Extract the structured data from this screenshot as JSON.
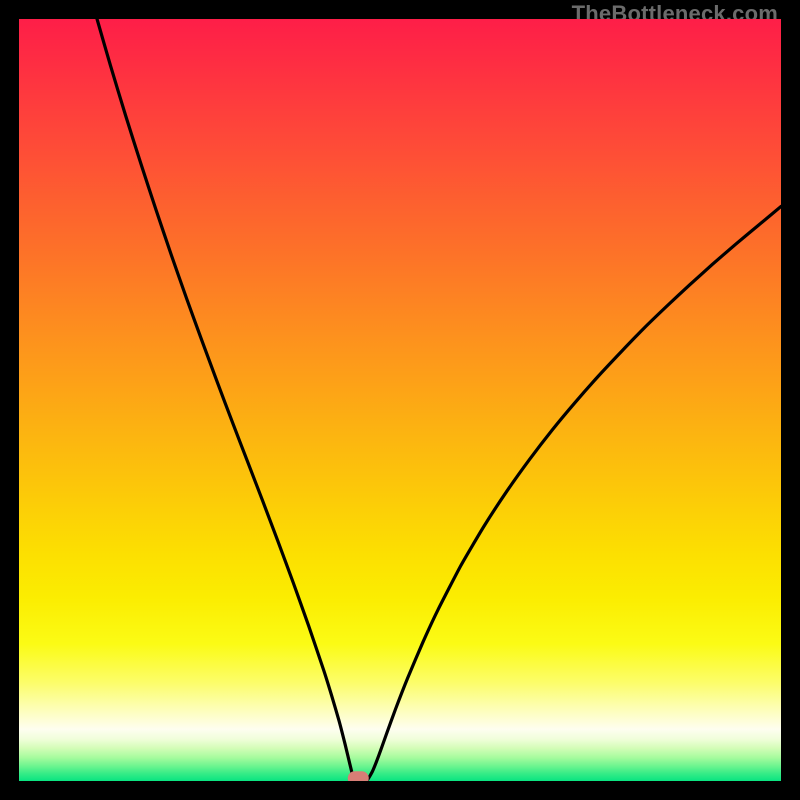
{
  "watermark": {
    "text": "TheBottleneck.com"
  },
  "colors": {
    "dot": "#d77e76",
    "curve": "#000000",
    "gradient_stops": [
      {
        "offset": 0.0,
        "color": "#fe1e48"
      },
      {
        "offset": 0.06,
        "color": "#fe2e42"
      },
      {
        "offset": 0.12,
        "color": "#fe3f3c"
      },
      {
        "offset": 0.18,
        "color": "#fe4f36"
      },
      {
        "offset": 0.24,
        "color": "#fd602f"
      },
      {
        "offset": 0.3,
        "color": "#fd7029"
      },
      {
        "offset": 0.36,
        "color": "#fd8123"
      },
      {
        "offset": 0.42,
        "color": "#fd921d"
      },
      {
        "offset": 0.48,
        "color": "#fda217"
      },
      {
        "offset": 0.54,
        "color": "#fcb311"
      },
      {
        "offset": 0.6,
        "color": "#fcc30b"
      },
      {
        "offset": 0.66,
        "color": "#fcd405"
      },
      {
        "offset": 0.7,
        "color": "#fcdf01"
      },
      {
        "offset": 0.76,
        "color": "#fbed01"
      },
      {
        "offset": 0.82,
        "color": "#fbfb15"
      },
      {
        "offset": 0.87,
        "color": "#fcfd68"
      },
      {
        "offset": 0.91,
        "color": "#fdfec1"
      },
      {
        "offset": 0.932,
        "color": "#fefef0"
      },
      {
        "offset": 0.945,
        "color": "#f0feda"
      },
      {
        "offset": 0.957,
        "color": "#d3fdb7"
      },
      {
        "offset": 0.969,
        "color": "#a7fb9e"
      },
      {
        "offset": 0.98,
        "color": "#6ef590"
      },
      {
        "offset": 0.99,
        "color": "#37ec87"
      },
      {
        "offset": 1.0,
        "color": "#09e481"
      }
    ]
  },
  "chart_data": {
    "type": "line",
    "title": "",
    "xlabel": "",
    "ylabel": "",
    "xlim": [
      0,
      100
    ],
    "ylim": [
      0,
      100
    ],
    "minimum_point": {
      "x": 44.5,
      "y": 0
    },
    "series": [
      {
        "name": "bottleneck-curve",
        "points": [
          {
            "x": 10.24,
            "y": 100.0
          },
          {
            "x": 12.0,
            "y": 93.9
          },
          {
            "x": 14.0,
            "y": 87.3
          },
          {
            "x": 16.0,
            "y": 81.0
          },
          {
            "x": 18.0,
            "y": 74.9
          },
          {
            "x": 20.0,
            "y": 69.0
          },
          {
            "x": 22.0,
            "y": 63.3
          },
          {
            "x": 24.0,
            "y": 57.8
          },
          {
            "x": 26.0,
            "y": 52.4
          },
          {
            "x": 28.0,
            "y": 47.1
          },
          {
            "x": 30.0,
            "y": 41.9
          },
          {
            "x": 32.0,
            "y": 36.7
          },
          {
            "x": 34.0,
            "y": 31.4
          },
          {
            "x": 36.0,
            "y": 26.0
          },
          {
            "x": 38.0,
            "y": 20.4
          },
          {
            "x": 40.0,
            "y": 14.5
          },
          {
            "x": 41.0,
            "y": 11.3
          },
          {
            "x": 42.0,
            "y": 7.9
          },
          {
            "x": 42.8,
            "y": 4.8
          },
          {
            "x": 43.4,
            "y": 2.3
          },
          {
            "x": 43.8,
            "y": 0.7
          },
          {
            "x": 44.1,
            "y": 0.1
          },
          {
            "x": 44.5,
            "y": 0.0
          },
          {
            "x": 45.0,
            "y": 0.0
          },
          {
            "x": 45.35,
            "y": 0.0
          },
          {
            "x": 45.8,
            "y": 0.25
          },
          {
            "x": 46.4,
            "y": 1.3
          },
          {
            "x": 47.2,
            "y": 3.3
          },
          {
            "x": 48.2,
            "y": 6.1
          },
          {
            "x": 49.4,
            "y": 9.4
          },
          {
            "x": 51.0,
            "y": 13.5
          },
          {
            "x": 53.0,
            "y": 18.2
          },
          {
            "x": 55.0,
            "y": 22.5
          },
          {
            "x": 58.0,
            "y": 28.3
          },
          {
            "x": 61.0,
            "y": 33.4
          },
          {
            "x": 64.0,
            "y": 38.0
          },
          {
            "x": 67.0,
            "y": 42.2
          },
          {
            "x": 70.0,
            "y": 46.1
          },
          {
            "x": 73.0,
            "y": 49.7
          },
          {
            "x": 76.0,
            "y": 53.1
          },
          {
            "x": 79.0,
            "y": 56.3
          },
          {
            "x": 82.0,
            "y": 59.4
          },
          {
            "x": 85.0,
            "y": 62.3
          },
          {
            "x": 88.0,
            "y": 65.1
          },
          {
            "x": 91.0,
            "y": 67.8
          },
          {
            "x": 94.0,
            "y": 70.4
          },
          {
            "x": 97.0,
            "y": 72.9
          },
          {
            "x": 100.0,
            "y": 75.4
          }
        ]
      }
    ]
  }
}
